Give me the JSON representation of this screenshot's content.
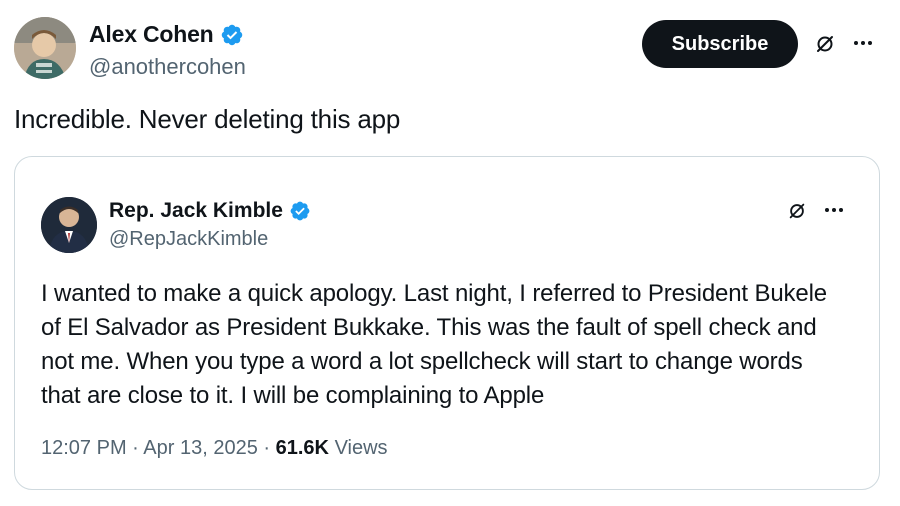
{
  "tweet": {
    "author": {
      "display_name": "Alex Cohen",
      "handle": "@anothercohen",
      "verified": true
    },
    "subscribe_label": "Subscribe",
    "text": "Incredible. Never deleting this app"
  },
  "quoted_tweet": {
    "author": {
      "display_name": "Rep. Jack Kimble",
      "handle": "@RepJackKimble",
      "verified": true
    },
    "text": "I wanted to make a quick apology. Last night, I referred to President Bukele of El Salvador as President Bukkake. This was the fault of spell check and not me. When you type a word a lot spellcheck will start to change words that are close to it. I will be complaining to Apple",
    "time": "12:07 PM",
    "separator": "·",
    "date": "Apr 13, 2025",
    "views_count": "61.6K",
    "views_label": "Views"
  },
  "icons": {
    "verified": "verified-badge-icon",
    "grok": "grok-icon",
    "more": "more-options-icon"
  },
  "colors": {
    "verified_blue": "#1d9bf0",
    "button_bg": "#0f1419",
    "secondary_text": "#536471",
    "border": "#cfd9de"
  }
}
